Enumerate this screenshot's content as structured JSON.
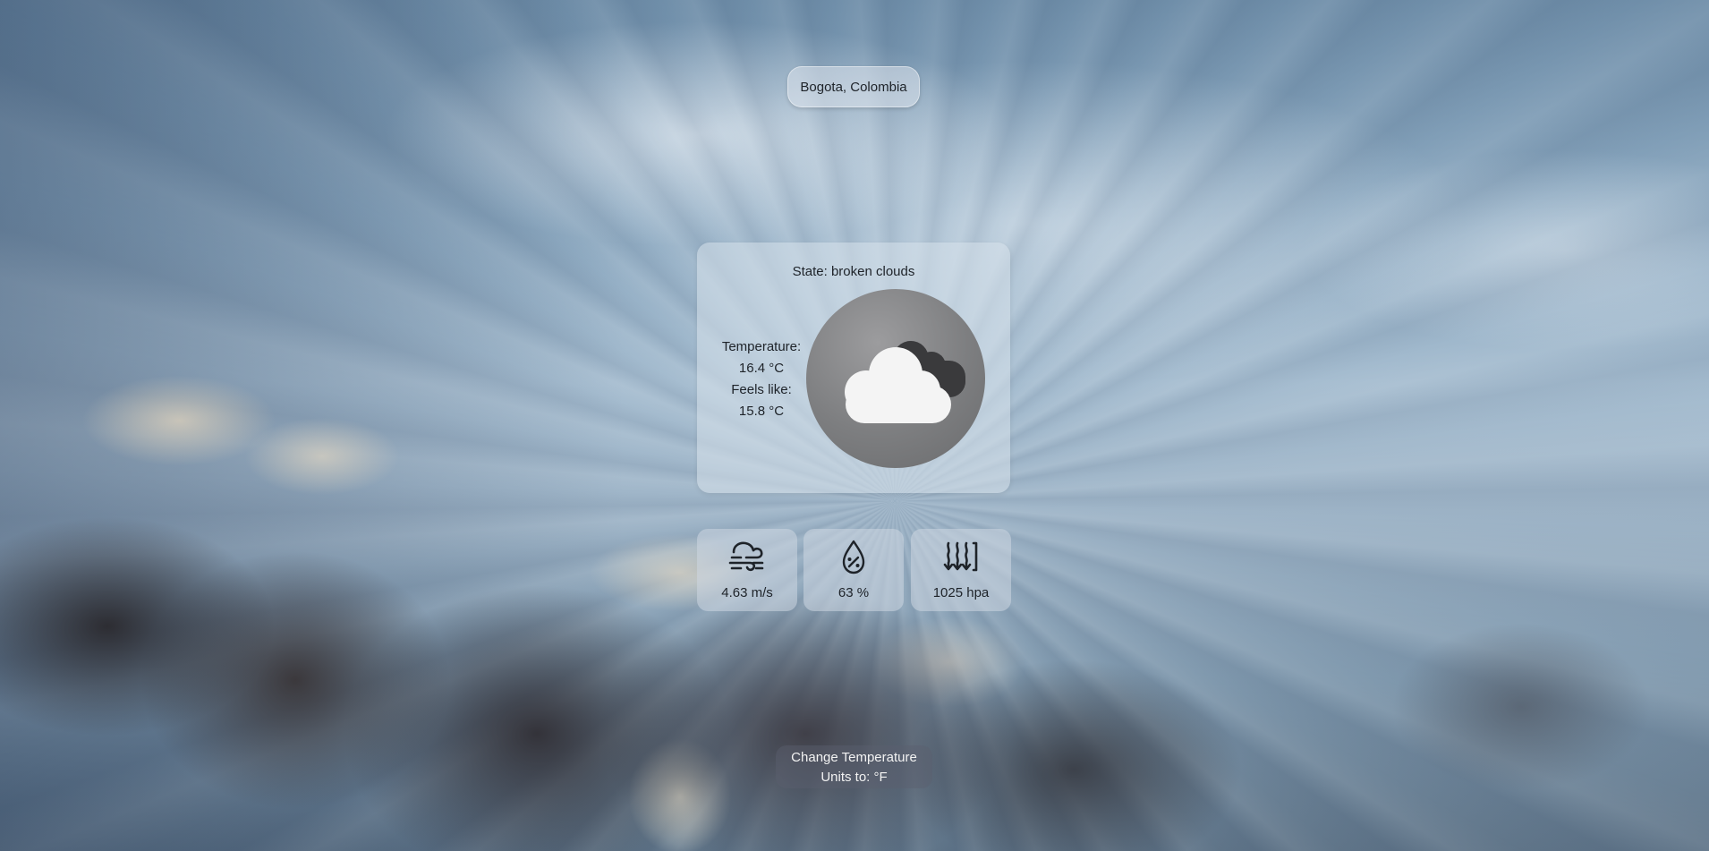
{
  "location": {
    "label": "Bogota, Colombia"
  },
  "weather": {
    "state_text": "State: broken clouds",
    "temperature_label": "Temperature:",
    "temperature_value": "16.4 °C",
    "feels_like_label": "Feels like:",
    "feels_like_value": "15.8 °C",
    "icon": "broken-clouds-icon"
  },
  "stats": [
    {
      "name": "wind",
      "icon": "wind-icon",
      "value": "4.63 m/s"
    },
    {
      "name": "humidity",
      "icon": "humidity-icon",
      "value": "63 %"
    },
    {
      "name": "pressure",
      "icon": "pressure-icon",
      "value": "1025 hpa"
    }
  ],
  "units_button": {
    "line1": "Change Temperature",
    "line2": "Units to: °F"
  },
  "colors": {
    "card_bg": "#d7e1eb",
    "icon_circle": "#7d7e80",
    "button_bg": "#5a5f6e"
  }
}
